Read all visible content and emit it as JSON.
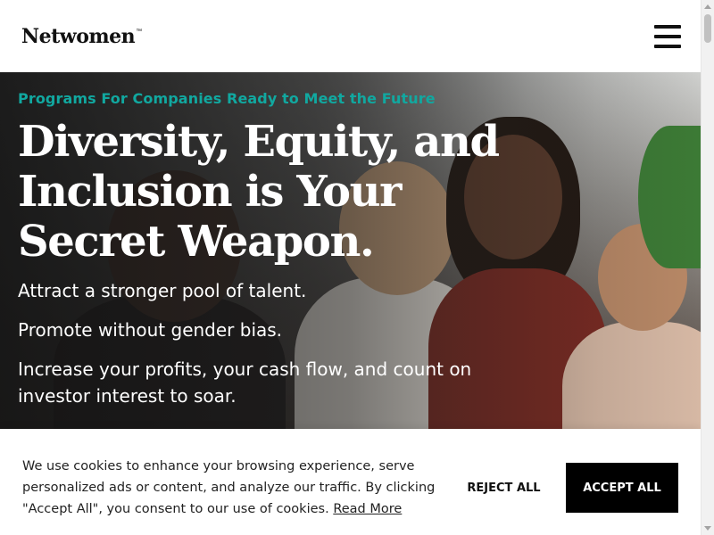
{
  "header": {
    "logo_text": "Netwomen",
    "logo_tm": "™",
    "menu_icon": "hamburger-icon"
  },
  "hero": {
    "eyebrow": "Programs For Companies Ready to Meet the Future",
    "headline": "Diversity, Equity, and Inclusion is Your Secret Weapon.",
    "line1": "Attract a stronger pool of talent.",
    "line2": "Promote without gender bias.",
    "line3": "Increase your profits, your cash flow, and count on investor interest to soar."
  },
  "cookie": {
    "message": "We use cookies to enhance your browsing experience, serve personalized ads or content, and analyze our traffic. By clicking \"Accept All\", you consent to our use of cookies.",
    "read_more": "Read More",
    "reject_label": "REJECT ALL",
    "accept_label": "ACCEPT ALL"
  },
  "colors": {
    "accent": "#11a8a0",
    "accept_button": "#000000"
  }
}
